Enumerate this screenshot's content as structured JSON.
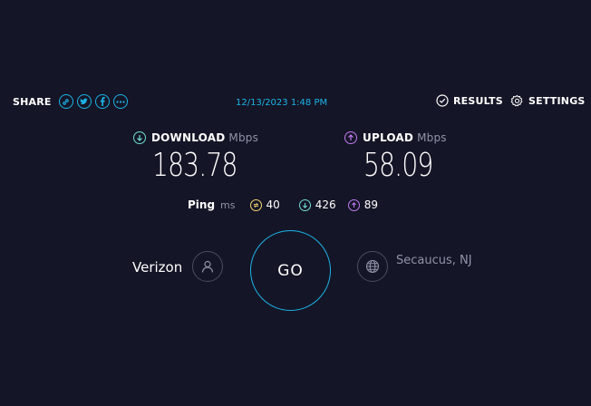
{
  "share": {
    "label": "SHARE",
    "icons": [
      "link-icon",
      "twitter-icon",
      "facebook-icon",
      "more-icon"
    ]
  },
  "timestamp": "12/13/2023 1:48 PM",
  "nav": {
    "results_label": "RESULTS",
    "settings_label": "SETTINGS"
  },
  "download": {
    "label": "DOWNLOAD",
    "unit": "Mbps",
    "value": "183.78"
  },
  "upload": {
    "label": "UPLOAD",
    "unit": "Mbps",
    "value": "58.09"
  },
  "ping": {
    "label": "Ping",
    "unit": "ms",
    "idle": "40",
    "download": "426",
    "upload": "89"
  },
  "isp": "Verizon",
  "server": "Secaucus, NJ",
  "go_label": "GO",
  "colors": {
    "background": "#141526",
    "accent": "#1db3e8",
    "download": "#6fe0d3",
    "upload": "#c27bf2",
    "ping": "#f5d76e",
    "muted": "#9193a8"
  }
}
